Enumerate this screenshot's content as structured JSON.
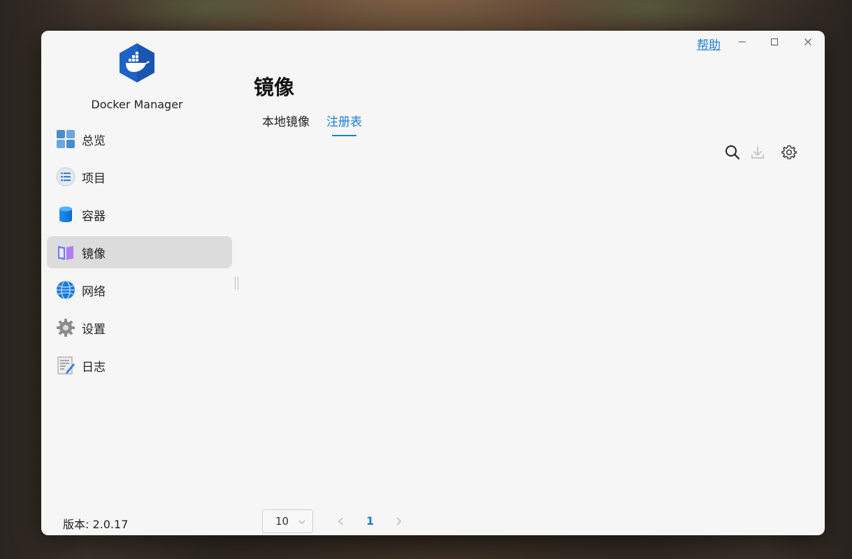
{
  "app": {
    "name": "Docker Manager",
    "version": "版本: 2.0.17"
  },
  "titlebar": {
    "help": "帮助"
  },
  "sidebar": {
    "items": [
      {
        "label": "总览",
        "icon": "overview-icon"
      },
      {
        "label": "项目",
        "icon": "projects-icon"
      },
      {
        "label": "容器",
        "icon": "container-icon"
      },
      {
        "label": "镜像",
        "icon": "image-icon",
        "active": true
      },
      {
        "label": "网络",
        "icon": "network-icon"
      },
      {
        "label": "设置",
        "icon": "settings-icon"
      },
      {
        "label": "日志",
        "icon": "log-icon"
      }
    ]
  },
  "main": {
    "title": "镜像",
    "tabs": [
      {
        "label": "本地镜像"
      },
      {
        "label": "注册表",
        "active": true
      }
    ],
    "toolbar": {
      "icons": [
        "search-icon",
        "download-icon",
        "gear-icon"
      ]
    }
  },
  "pagination": {
    "page_size": "10",
    "current_page": "1"
  },
  "colors": {
    "accent": "#1a7fd4",
    "active_nav_bg": "#dcdcdc",
    "window_bg": "#f6f6f6"
  }
}
